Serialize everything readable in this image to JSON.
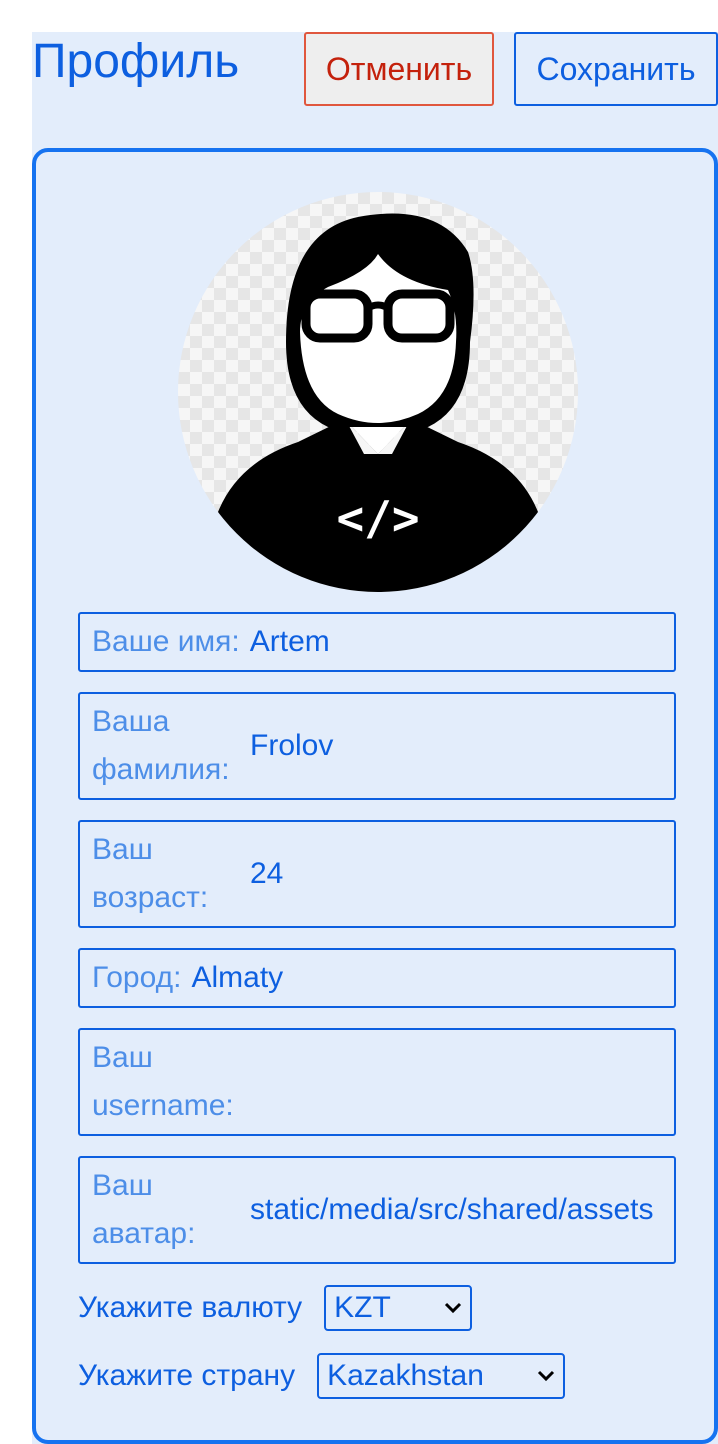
{
  "header": {
    "title": "Профиль",
    "cancel_label": "Отменить",
    "save_label": "Сохранить"
  },
  "avatar": {
    "icon": "developer-avatar-icon",
    "badge_text": "</>"
  },
  "fields": {
    "name": {
      "label": "Ваше имя:",
      "value": "Artem"
    },
    "surname": {
      "label": "Ваша фамилия:",
      "value": "Frolov"
    },
    "age": {
      "label": "Ваш возраст:",
      "value": "24"
    },
    "city": {
      "label": "Город:",
      "value": "Almaty"
    },
    "username": {
      "label": "Ваш username:",
      "value": ""
    },
    "avatar": {
      "label": "Ваш аватар:",
      "value": "static/media/src/shared/assets"
    }
  },
  "selects": {
    "currency": {
      "label": "Укажите валюту",
      "value": "KZT"
    },
    "country": {
      "label": "Укажите страну",
      "value": "Kazakhstan"
    }
  },
  "colors": {
    "accent": "#0d5fe0",
    "background": "#e3edfb",
    "cancel": "#c4210c"
  }
}
